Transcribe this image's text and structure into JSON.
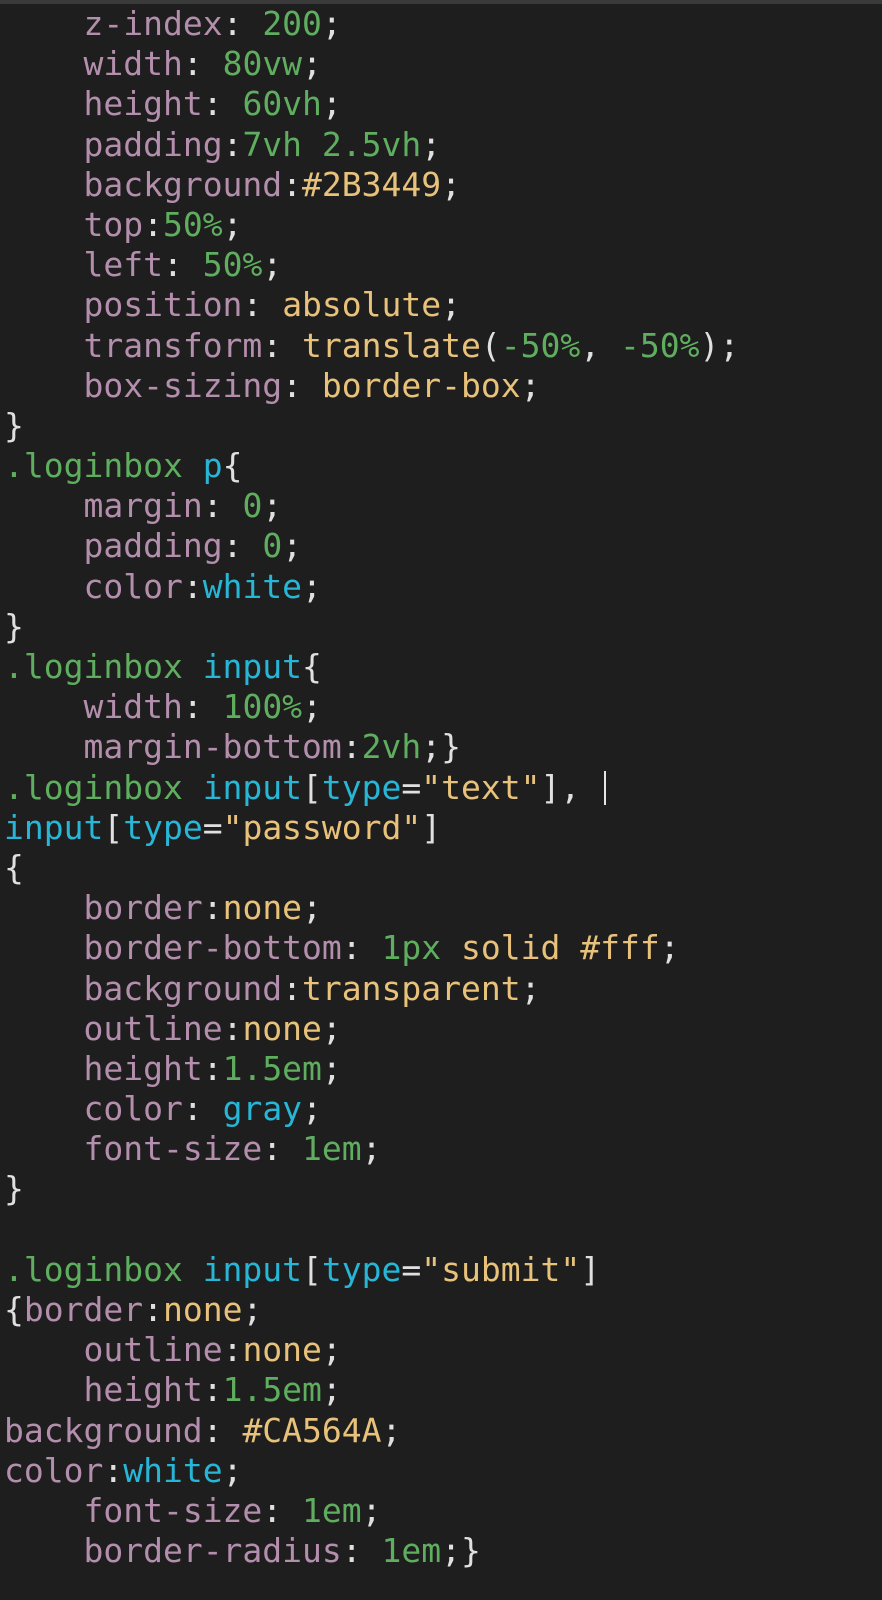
{
  "editor": {
    "lines": [
      [
        {
          "t": "    ",
          "k": "punc"
        },
        {
          "t": "z-index",
          "k": "prop"
        },
        {
          "t": ": ",
          "k": "punc"
        },
        {
          "t": "200",
          "k": "num"
        },
        {
          "t": ";",
          "k": "punc"
        }
      ],
      [
        {
          "t": "    ",
          "k": "punc"
        },
        {
          "t": "width",
          "k": "prop"
        },
        {
          "t": ": ",
          "k": "punc"
        },
        {
          "t": "80vw",
          "k": "num"
        },
        {
          "t": ";",
          "k": "punc"
        }
      ],
      [
        {
          "t": "    ",
          "k": "punc"
        },
        {
          "t": "height",
          "k": "prop"
        },
        {
          "t": ": ",
          "k": "punc"
        },
        {
          "t": "60vh",
          "k": "num"
        },
        {
          "t": ";",
          "k": "punc"
        }
      ],
      [
        {
          "t": "    ",
          "k": "punc"
        },
        {
          "t": "padding",
          "k": "prop"
        },
        {
          "t": ":",
          "k": "punc"
        },
        {
          "t": "7vh 2.5vh",
          "k": "num"
        },
        {
          "t": ";",
          "k": "punc"
        }
      ],
      [
        {
          "t": "    ",
          "k": "punc"
        },
        {
          "t": "background",
          "k": "prop"
        },
        {
          "t": ":",
          "k": "punc"
        },
        {
          "t": "#2B3449",
          "k": "color"
        },
        {
          "t": ";",
          "k": "punc"
        }
      ],
      [
        {
          "t": "    ",
          "k": "punc"
        },
        {
          "t": "top",
          "k": "prop"
        },
        {
          "t": ":",
          "k": "punc"
        },
        {
          "t": "50%",
          "k": "num"
        },
        {
          "t": ";",
          "k": "punc"
        }
      ],
      [
        {
          "t": "    ",
          "k": "punc"
        },
        {
          "t": "left",
          "k": "prop"
        },
        {
          "t": ": ",
          "k": "punc"
        },
        {
          "t": "50%",
          "k": "num"
        },
        {
          "t": ";",
          "k": "punc"
        }
      ],
      [
        {
          "t": "    ",
          "k": "punc"
        },
        {
          "t": "position",
          "k": "prop"
        },
        {
          "t": ": ",
          "k": "punc"
        },
        {
          "t": "absolute",
          "k": "kw"
        },
        {
          "t": ";",
          "k": "punc"
        }
      ],
      [
        {
          "t": "    ",
          "k": "punc"
        },
        {
          "t": "transform",
          "k": "prop"
        },
        {
          "t": ": ",
          "k": "punc"
        },
        {
          "t": "translate",
          "k": "kw"
        },
        {
          "t": "(",
          "k": "punc"
        },
        {
          "t": "-50%",
          "k": "num"
        },
        {
          "t": ", ",
          "k": "punc"
        },
        {
          "t": "-50%",
          "k": "num"
        },
        {
          "t": ");",
          "k": "punc"
        }
      ],
      [
        {
          "t": "    ",
          "k": "punc"
        },
        {
          "t": "box-sizing",
          "k": "prop"
        },
        {
          "t": ": ",
          "k": "punc"
        },
        {
          "t": "border-box",
          "k": "kw"
        },
        {
          "t": ";",
          "k": "punc"
        }
      ],
      [
        {
          "t": "}",
          "k": "punc"
        }
      ],
      [
        {
          "t": ".loginbox ",
          "k": "cls"
        },
        {
          "t": "p",
          "k": "tag"
        },
        {
          "t": "{",
          "k": "punc"
        }
      ],
      [
        {
          "t": "    ",
          "k": "punc"
        },
        {
          "t": "margin",
          "k": "prop"
        },
        {
          "t": ": ",
          "k": "punc"
        },
        {
          "t": "0",
          "k": "num"
        },
        {
          "t": ";",
          "k": "punc"
        }
      ],
      [
        {
          "t": "    ",
          "k": "punc"
        },
        {
          "t": "padding",
          "k": "prop"
        },
        {
          "t": ": ",
          "k": "punc"
        },
        {
          "t": "0",
          "k": "num"
        },
        {
          "t": ";",
          "k": "punc"
        }
      ],
      [
        {
          "t": "    ",
          "k": "punc"
        },
        {
          "t": "color",
          "k": "prop"
        },
        {
          "t": ":",
          "k": "punc"
        },
        {
          "t": "white",
          "k": "named"
        },
        {
          "t": ";",
          "k": "punc"
        }
      ],
      [
        {
          "t": "}",
          "k": "punc"
        }
      ],
      [
        {
          "t": ".loginbox ",
          "k": "cls"
        },
        {
          "t": "input",
          "k": "tag"
        },
        {
          "t": "{",
          "k": "punc"
        }
      ],
      [
        {
          "t": "    ",
          "k": "punc"
        },
        {
          "t": "width",
          "k": "prop"
        },
        {
          "t": ": ",
          "k": "punc"
        },
        {
          "t": "100%",
          "k": "num"
        },
        {
          "t": ";",
          "k": "punc"
        }
      ],
      [
        {
          "t": "    ",
          "k": "punc"
        },
        {
          "t": "margin-bottom",
          "k": "prop"
        },
        {
          "t": ":",
          "k": "punc"
        },
        {
          "t": "2vh",
          "k": "num"
        },
        {
          "t": ";}",
          "k": "punc"
        }
      ],
      [
        {
          "t": ".loginbox ",
          "k": "cls"
        },
        {
          "t": "input",
          "k": "tag"
        },
        {
          "t": "[",
          "k": "punc"
        },
        {
          "t": "type",
          "k": "attr"
        },
        {
          "t": "=",
          "k": "punc"
        },
        {
          "t": "\"text\"",
          "k": "str"
        },
        {
          "t": "], ",
          "k": "punc"
        },
        {
          "t": "",
          "k": "caret"
        }
      ],
      [
        {
          "t": "input",
          "k": "tag"
        },
        {
          "t": "[",
          "k": "punc"
        },
        {
          "t": "type",
          "k": "attr"
        },
        {
          "t": "=",
          "k": "punc"
        },
        {
          "t": "\"password\"",
          "k": "str"
        },
        {
          "t": "]",
          "k": "punc"
        }
      ],
      [
        {
          "t": "{",
          "k": "punc"
        }
      ],
      [
        {
          "t": "    ",
          "k": "punc"
        },
        {
          "t": "border",
          "k": "prop"
        },
        {
          "t": ":",
          "k": "punc"
        },
        {
          "t": "none",
          "k": "kw"
        },
        {
          "t": ";",
          "k": "punc"
        }
      ],
      [
        {
          "t": "    ",
          "k": "punc"
        },
        {
          "t": "border-bottom",
          "k": "prop"
        },
        {
          "t": ": ",
          "k": "punc"
        },
        {
          "t": "1px",
          "k": "num"
        },
        {
          "t": " ",
          "k": "punc"
        },
        {
          "t": "solid",
          "k": "kw"
        },
        {
          "t": " ",
          "k": "punc"
        },
        {
          "t": "#fff",
          "k": "color"
        },
        {
          "t": ";",
          "k": "punc"
        }
      ],
      [
        {
          "t": "    ",
          "k": "punc"
        },
        {
          "t": "background",
          "k": "prop"
        },
        {
          "t": ":",
          "k": "punc"
        },
        {
          "t": "transparent",
          "k": "kw"
        },
        {
          "t": ";",
          "k": "punc"
        }
      ],
      [
        {
          "t": "    ",
          "k": "punc"
        },
        {
          "t": "outline",
          "k": "prop"
        },
        {
          "t": ":",
          "k": "punc"
        },
        {
          "t": "none",
          "k": "kw"
        },
        {
          "t": ";",
          "k": "punc"
        }
      ],
      [
        {
          "t": "    ",
          "k": "punc"
        },
        {
          "t": "height",
          "k": "prop"
        },
        {
          "t": ":",
          "k": "punc"
        },
        {
          "t": "1.5em",
          "k": "num"
        },
        {
          "t": ";",
          "k": "punc"
        }
      ],
      [
        {
          "t": "    ",
          "k": "punc"
        },
        {
          "t": "color",
          "k": "prop"
        },
        {
          "t": ": ",
          "k": "punc"
        },
        {
          "t": "gray",
          "k": "named"
        },
        {
          "t": ";",
          "k": "punc"
        }
      ],
      [
        {
          "t": "    ",
          "k": "punc"
        },
        {
          "t": "font-size",
          "k": "prop"
        },
        {
          "t": ": ",
          "k": "punc"
        },
        {
          "t": "1em",
          "k": "num"
        },
        {
          "t": ";",
          "k": "punc"
        }
      ],
      [
        {
          "t": "}",
          "k": "punc"
        }
      ],
      [
        {
          "t": "",
          "k": "punc"
        }
      ],
      [
        {
          "t": ".loginbox ",
          "k": "cls"
        },
        {
          "t": "input",
          "k": "tag"
        },
        {
          "t": "[",
          "k": "punc"
        },
        {
          "t": "type",
          "k": "attr"
        },
        {
          "t": "=",
          "k": "punc"
        },
        {
          "t": "\"submit\"",
          "k": "str"
        },
        {
          "t": "]",
          "k": "punc"
        }
      ],
      [
        {
          "t": "{",
          "k": "punc"
        },
        {
          "t": "border",
          "k": "prop"
        },
        {
          "t": ":",
          "k": "punc"
        },
        {
          "t": "none",
          "k": "kw"
        },
        {
          "t": ";",
          "k": "punc"
        }
      ],
      [
        {
          "t": "    ",
          "k": "punc"
        },
        {
          "t": "outline",
          "k": "prop"
        },
        {
          "t": ":",
          "k": "punc"
        },
        {
          "t": "none",
          "k": "kw"
        },
        {
          "t": ";",
          "k": "punc"
        }
      ],
      [
        {
          "t": "    ",
          "k": "punc"
        },
        {
          "t": "height",
          "k": "prop"
        },
        {
          "t": ":",
          "k": "punc"
        },
        {
          "t": "1.5em",
          "k": "num"
        },
        {
          "t": ";",
          "k": "punc"
        }
      ],
      [
        {
          "t": "background",
          "k": "prop"
        },
        {
          "t": ": ",
          "k": "punc"
        },
        {
          "t": "#CA564A",
          "k": "color"
        },
        {
          "t": ";",
          "k": "punc"
        }
      ],
      [
        {
          "t": "color",
          "k": "prop"
        },
        {
          "t": ":",
          "k": "punc"
        },
        {
          "t": "white",
          "k": "named"
        },
        {
          "t": ";",
          "k": "punc"
        }
      ],
      [
        {
          "t": "    ",
          "k": "punc"
        },
        {
          "t": "font-size",
          "k": "prop"
        },
        {
          "t": ": ",
          "k": "punc"
        },
        {
          "t": "1em",
          "k": "num"
        },
        {
          "t": ";",
          "k": "punc"
        }
      ],
      [
        {
          "t": "    ",
          "k": "punc"
        },
        {
          "t": "border-radius",
          "k": "prop"
        },
        {
          "t": ": ",
          "k": "punc"
        },
        {
          "t": "1em",
          "k": "num"
        },
        {
          "t": ";}",
          "k": "punc"
        }
      ]
    ]
  }
}
